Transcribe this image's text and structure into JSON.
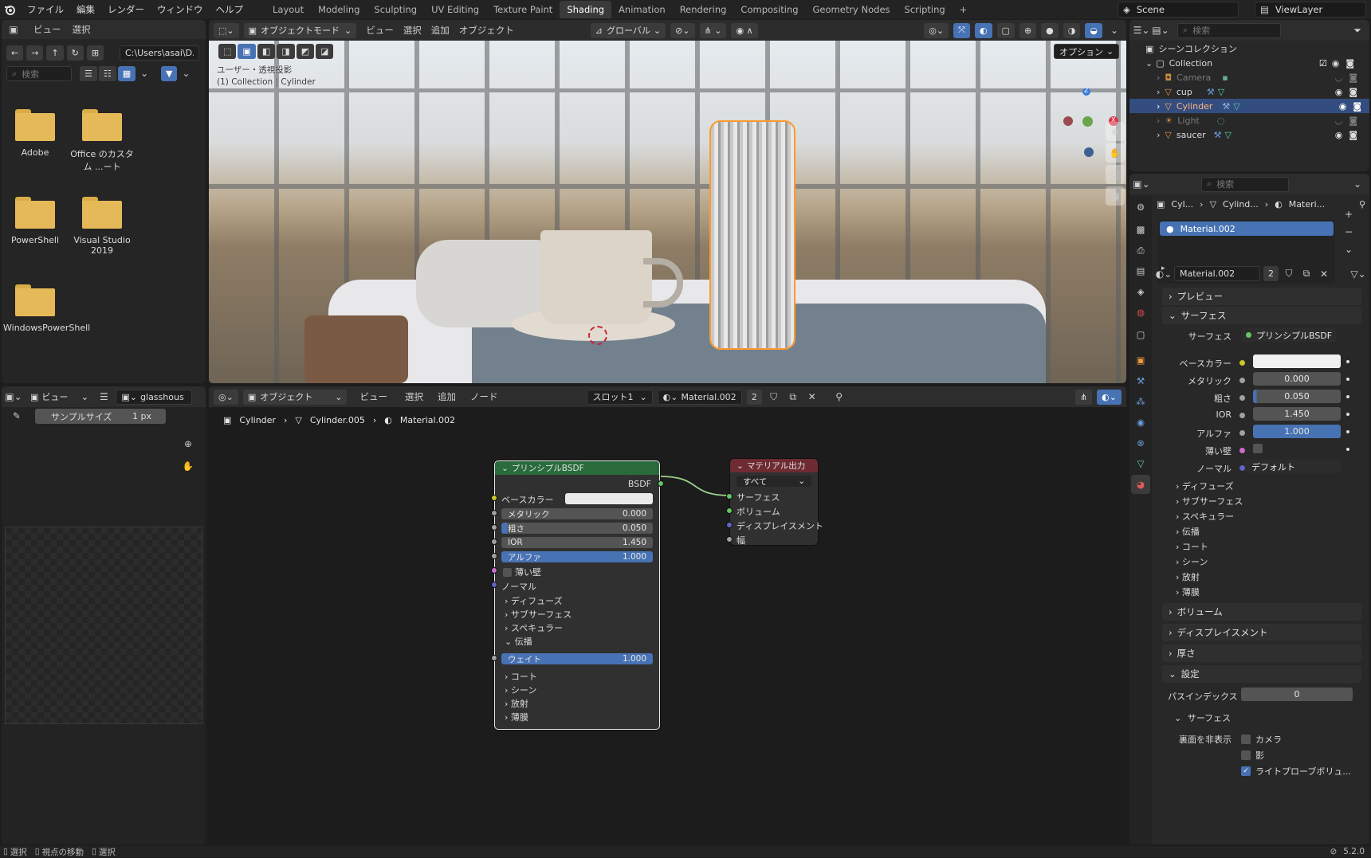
{
  "menu": [
    "ファイル",
    "編集",
    "レンダー",
    "ウィンドウ",
    "ヘルプ"
  ],
  "workspaces": [
    "Layout",
    "Modeling",
    "Sculpting",
    "UV Editing",
    "Texture Paint",
    "Shading",
    "Animation",
    "Rendering",
    "Compositing",
    "Geometry Nodes",
    "Scripting"
  ],
  "active_workspace": "Shading",
  "scene": "Scene",
  "view_layer": "ViewLayer",
  "filebrowser": {
    "menu": [
      "ビュー",
      "選択"
    ],
    "path": "C:\\Users\\asai\\D...",
    "search_placeholder": "検索",
    "folders": [
      "Adobe",
      "Office のカスタム ...ート",
      "PowerShell",
      "Visual Studio 2019",
      "WindowsPowerShell"
    ]
  },
  "viewport": {
    "mode": "オブジェクトモード",
    "menu": [
      "ビュー",
      "選択",
      "追加",
      "オブジェクト"
    ],
    "transform": "グローバル",
    "options": "オプション",
    "overlay_line1": "ユーザー・透視投影",
    "overlay_line2": "(1) Collection | Cylinder",
    "gizmo": {
      "z": "Z",
      "x": "X"
    }
  },
  "image_editor": {
    "view": "ビュー",
    "image": "glasshous",
    "sample_label": "サンプルサイズ",
    "sample_value": "1 px"
  },
  "node_editor": {
    "mode": "オブジェクト",
    "menu": [
      "ビュー",
      "選択",
      "追加",
      "ノード"
    ],
    "slot": "スロット1",
    "material": "Material.002",
    "users": "2",
    "breadcrumb": [
      "Cylinder",
      "Cylinder.005",
      "Material.002"
    ],
    "bsdf": {
      "title": "プリンシプルBSDF",
      "output": "BSDF",
      "base_color": "ベースカラー",
      "fields": [
        {
          "label": "メタリック",
          "value": "0.000"
        },
        {
          "label": "粗さ",
          "value": "0.050"
        },
        {
          "label": "IOR",
          "value": "1.450"
        },
        {
          "label": "アルファ",
          "value": "1.000"
        }
      ],
      "thin_wall": "薄い壁",
      "normal": "ノーマル",
      "subpanels_a": [
        "ディフューズ",
        "サブサーフェス",
        "スペキュラー"
      ],
      "transmission": "伝播",
      "weight_label": "ウェイト",
      "weight_value": "1.000",
      "subpanels_b": [
        "コート",
        "シーン",
        "放射",
        "薄膜"
      ]
    },
    "output_node": {
      "title": "マテリアル出力",
      "target": "すべて",
      "inputs": [
        "サーフェス",
        "ボリューム",
        "ディスプレイスメント",
        "幅"
      ]
    }
  },
  "outliner": {
    "search_placeholder": "検索",
    "root": "シーンコレクション",
    "collection": "Collection",
    "items": [
      "Camera",
      "cup",
      "Cylinder",
      "Light",
      "saucer"
    ],
    "selected": "Cylinder"
  },
  "properties": {
    "search_placeholder": "検索",
    "breadcrumb": [
      "Cyl...",
      "Cylind...",
      "Materi..."
    ],
    "slot": "Material.002",
    "material": "Material.002",
    "users": "2",
    "preview": "プレビュー",
    "surface": "サーフェス",
    "surface_label": "サーフェス",
    "surface_value": "プリンシプルBSDF",
    "base_color": "ベースカラー",
    "rows": [
      {
        "label": "メタリック",
        "value": "0.000"
      },
      {
        "label": "粗さ",
        "value": "0.050"
      },
      {
        "label": "IOR",
        "value": "1.450"
      },
      {
        "label": "アルファ",
        "value": "1.000"
      }
    ],
    "thin_wall": "薄い壁",
    "normal_label": "ノーマル",
    "normal_value": "デフォルト",
    "subpanels": [
      "ディフューズ",
      "サブサーフェス",
      "スペキュラー",
      "伝播",
      "コート",
      "シーン",
      "放射",
      "薄膜"
    ],
    "volume": "ボリューム",
    "displacement": "ディスプレイスメント",
    "thickness": "厚さ",
    "settings": "設定",
    "pass_index_label": "パスインデックス",
    "pass_index_value": "0",
    "settings_surface": "サーフェス",
    "backface_label": "裏面を非表示",
    "backface_camera": "カメラ",
    "backface_shadow": "影",
    "light_probe": "ライトプローブボリュ..."
  },
  "status": {
    "items": [
      "選択",
      "視点の移動",
      "選択"
    ],
    "version": "5.2.0"
  },
  "colors": {
    "accent": "#4772b3",
    "selection": "#ff9a2e",
    "bsdf_header": "#2a6b3b",
    "output_header": "#6e2b31"
  }
}
